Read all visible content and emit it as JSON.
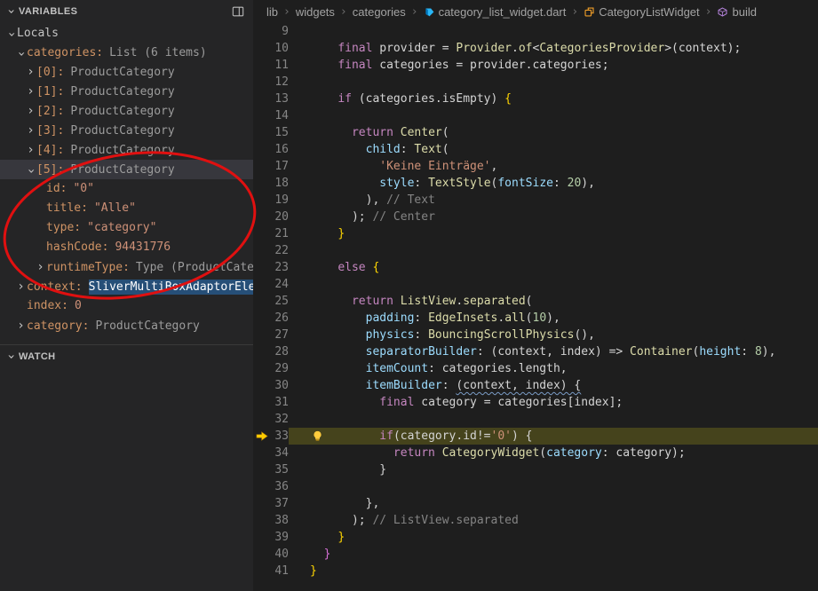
{
  "sidebar": {
    "variables_header": "VARIABLES",
    "watch_header": "WATCH",
    "tree": [
      {
        "level": 0,
        "state": "open",
        "name": "Locals",
        "nameClass": "plain"
      },
      {
        "level": 1,
        "state": "open",
        "name": "categories:",
        "value": "List (6 items)"
      },
      {
        "level": 2,
        "state": "closed",
        "name": "[0]:",
        "value": "ProductCategory"
      },
      {
        "level": 2,
        "state": "closed",
        "name": "[1]:",
        "value": "ProductCategory"
      },
      {
        "level": 2,
        "state": "closed",
        "name": "[2]:",
        "value": "ProductCategory"
      },
      {
        "level": 2,
        "state": "closed",
        "name": "[3]:",
        "value": "ProductCategory"
      },
      {
        "level": 2,
        "state": "closed",
        "name": "[4]:",
        "value": "ProductCategory"
      },
      {
        "level": 2,
        "state": "open",
        "name": "[5]:",
        "value": "ProductCategory",
        "selected": true
      },
      {
        "level": 3,
        "state": "leaf",
        "name": "id:",
        "value": "\"0\"",
        "valueClass": "str"
      },
      {
        "level": 3,
        "state": "leaf",
        "name": "title:",
        "value": "\"Alle\"",
        "valueClass": "str"
      },
      {
        "level": 3,
        "state": "leaf",
        "name": "type:",
        "value": "\"category\"",
        "valueClass": "str"
      },
      {
        "level": 3,
        "state": "leaf",
        "name": "hashCode:",
        "value": "94431776",
        "valueClass": "str"
      },
      {
        "level": 3,
        "state": "closed",
        "name": "runtimeType:",
        "value": "Type (ProductCateg…"
      },
      {
        "level": 1,
        "state": "closed",
        "name": "context:",
        "value": "SliverMultiBoxAdaptorElement",
        "valueClass": "selval"
      },
      {
        "level": 1,
        "state": "leaf",
        "name": "index:",
        "value": "0",
        "valueClass": "str"
      },
      {
        "level": 1,
        "state": "closed",
        "name": "category:",
        "value": "ProductCategory"
      }
    ]
  },
  "breadcrumb": {
    "separator": "›",
    "items": [
      {
        "label": "lib"
      },
      {
        "label": "widgets"
      },
      {
        "label": "categories"
      },
      {
        "label": "category_list_widget.dart",
        "icon": "dart"
      },
      {
        "label": "CategoryListWidget",
        "icon": "class"
      },
      {
        "label": "build",
        "icon": "method"
      }
    ]
  },
  "editor": {
    "lines": [
      {
        "n": 9,
        "seg": []
      },
      {
        "n": 10,
        "seg": [
          [
            "pln",
            "    "
          ],
          [
            "kw",
            "final"
          ],
          [
            "pln",
            " provider = "
          ],
          [
            "cls",
            "Provider"
          ],
          [
            "pln",
            "."
          ],
          [
            "cls",
            "of"
          ],
          [
            "pln",
            "<"
          ],
          [
            "cls",
            "CategoriesProvider"
          ],
          [
            "pln",
            ">(context);"
          ]
        ]
      },
      {
        "n": 11,
        "seg": [
          [
            "pln",
            "    "
          ],
          [
            "kw",
            "final"
          ],
          [
            "pln",
            " categories = provider.categories;"
          ]
        ]
      },
      {
        "n": 12,
        "seg": []
      },
      {
        "n": 13,
        "seg": [
          [
            "pln",
            "    "
          ],
          [
            "kw",
            "if"
          ],
          [
            "pln",
            " (categories.isEmpty) "
          ],
          [
            "b1",
            "{"
          ]
        ]
      },
      {
        "n": 14,
        "seg": []
      },
      {
        "n": 15,
        "seg": [
          [
            "pln",
            "      "
          ],
          [
            "kw",
            "return"
          ],
          [
            "pln",
            " "
          ],
          [
            "cls",
            "Center"
          ],
          [
            "pln",
            "("
          ]
        ]
      },
      {
        "n": 16,
        "seg": [
          [
            "pln",
            "        "
          ],
          [
            "prop",
            "child"
          ],
          [
            "pln",
            ": "
          ],
          [
            "cls",
            "Text"
          ],
          [
            "pln",
            "("
          ]
        ]
      },
      {
        "n": 17,
        "seg": [
          [
            "pln",
            "          "
          ],
          [
            "str",
            "'Keine Einträge'"
          ],
          [
            "pln",
            ","
          ]
        ]
      },
      {
        "n": 18,
        "seg": [
          [
            "pln",
            "          "
          ],
          [
            "prop",
            "style"
          ],
          [
            "pln",
            ": "
          ],
          [
            "cls",
            "TextStyle"
          ],
          [
            "pln",
            "("
          ],
          [
            "prop",
            "fontSize"
          ],
          [
            "pln",
            ": "
          ],
          [
            "num",
            "20"
          ],
          [
            "pln",
            "),"
          ]
        ]
      },
      {
        "n": 19,
        "seg": [
          [
            "pln",
            "        ), "
          ],
          [
            "cmt",
            "// Text"
          ]
        ]
      },
      {
        "n": 20,
        "seg": [
          [
            "pln",
            "      ); "
          ],
          [
            "cmt",
            "// Center"
          ]
        ]
      },
      {
        "n": 21,
        "seg": [
          [
            "pln",
            "    "
          ],
          [
            "b1",
            "}"
          ]
        ]
      },
      {
        "n": 22,
        "seg": []
      },
      {
        "n": 23,
        "seg": [
          [
            "pln",
            "    "
          ],
          [
            "kw",
            "else"
          ],
          [
            "pln",
            " "
          ],
          [
            "b1",
            "{"
          ]
        ]
      },
      {
        "n": 24,
        "seg": []
      },
      {
        "n": 25,
        "seg": [
          [
            "pln",
            "      "
          ],
          [
            "kw",
            "return"
          ],
          [
            "pln",
            " "
          ],
          [
            "cls",
            "ListView"
          ],
          [
            "pln",
            "."
          ],
          [
            "cls",
            "separated"
          ],
          [
            "pln",
            "("
          ]
        ]
      },
      {
        "n": 26,
        "seg": [
          [
            "pln",
            "        "
          ],
          [
            "prop",
            "padding"
          ],
          [
            "pln",
            ": "
          ],
          [
            "cls",
            "EdgeInsets"
          ],
          [
            "pln",
            "."
          ],
          [
            "cls",
            "all"
          ],
          [
            "pln",
            "("
          ],
          [
            "num",
            "10"
          ],
          [
            "pln",
            "),"
          ]
        ]
      },
      {
        "n": 27,
        "seg": [
          [
            "pln",
            "        "
          ],
          [
            "prop",
            "physics"
          ],
          [
            "pln",
            ": "
          ],
          [
            "cls",
            "BouncingScrollPhysics"
          ],
          [
            "pln",
            "(),"
          ]
        ]
      },
      {
        "n": 28,
        "seg": [
          [
            "pln",
            "        "
          ],
          [
            "prop",
            "separatorBuilder"
          ],
          [
            "pln",
            ": (context, index) => "
          ],
          [
            "cls",
            "Container"
          ],
          [
            "pln",
            "("
          ],
          [
            "prop",
            "height"
          ],
          [
            "pln",
            ": "
          ],
          [
            "num",
            "8"
          ],
          [
            "pln",
            "),"
          ]
        ]
      },
      {
        "n": 29,
        "seg": [
          [
            "pln",
            "        "
          ],
          [
            "prop",
            "itemCount"
          ],
          [
            "pln",
            ": categories.length,"
          ]
        ]
      },
      {
        "n": 30,
        "seg": [
          [
            "pln",
            "        "
          ],
          [
            "prop",
            "itemBuilder"
          ],
          [
            "pln",
            ": "
          ],
          [
            "sq",
            "(context, index) {"
          ]
        ]
      },
      {
        "n": 31,
        "seg": [
          [
            "pln",
            "          "
          ],
          [
            "kw",
            "final"
          ],
          [
            "pln",
            " category = categories[index];"
          ]
        ]
      },
      {
        "n": 32,
        "seg": []
      },
      {
        "n": 33,
        "hl": true,
        "arrow": true,
        "bulb": true,
        "seg": [
          [
            "pln",
            "          "
          ],
          [
            "kw",
            "if"
          ],
          [
            "pln",
            "(category.id!="
          ],
          [
            "str",
            "'0'"
          ],
          [
            "pln",
            ") {"
          ]
        ]
      },
      {
        "n": 34,
        "seg": [
          [
            "pln",
            "            "
          ],
          [
            "kw",
            "return"
          ],
          [
            "pln",
            " "
          ],
          [
            "cls",
            "CategoryWidget"
          ],
          [
            "pln",
            "("
          ],
          [
            "prop",
            "category"
          ],
          [
            "pln",
            ": category);"
          ]
        ]
      },
      {
        "n": 35,
        "seg": [
          [
            "pln",
            "          }"
          ]
        ]
      },
      {
        "n": 36,
        "seg": []
      },
      {
        "n": 37,
        "seg": [
          [
            "pln",
            "        },"
          ]
        ]
      },
      {
        "n": 38,
        "seg": [
          [
            "pln",
            "      ); "
          ],
          [
            "cmt",
            "// ListView.separated"
          ]
        ]
      },
      {
        "n": 39,
        "seg": [
          [
            "pln",
            "    "
          ],
          [
            "b1",
            "}"
          ]
        ]
      },
      {
        "n": 40,
        "seg": [
          [
            "pln",
            "  "
          ],
          [
            "b2",
            "}"
          ]
        ]
      },
      {
        "n": 41,
        "seg": [
          [
            "b1",
            "}"
          ]
        ]
      }
    ]
  },
  "annotation": {
    "type": "ellipse",
    "color": "#e01010"
  },
  "colors": {
    "editor_background": "#1e1e1e",
    "sidebar_background": "#252526",
    "selection_blue": "#264f78",
    "paused_line_highlight": "#45431c",
    "keyword": "#c586c0",
    "class_name": "#dcdcaa",
    "string": "#ce9178",
    "annotation_red": "#e01010"
  }
}
